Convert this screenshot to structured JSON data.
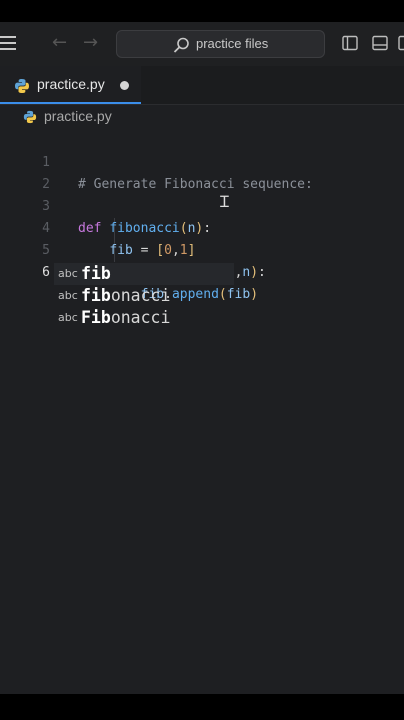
{
  "titlebar": {
    "menu_icon": "hamburger-menu-icon",
    "back_icon": "arrow-left-icon",
    "forward_icon": "arrow-right-icon",
    "search_icon": "search-icon",
    "search_label": "practice files",
    "layout_icons": [
      "toggle-sidebar-icon",
      "toggle-panel-icon"
    ]
  },
  "tab": {
    "label": "practice.py",
    "icon": "python-icon",
    "unsaved_indicator": "dot-icon"
  },
  "breadcrumb": {
    "label": "practice.py",
    "icon": "python-icon"
  },
  "editor": {
    "lines": [
      {
        "number": "1",
        "text": "# Generate Fibonacci sequence:"
      },
      {
        "number": "2",
        "text": ""
      },
      {
        "number": "3",
        "text": "def fibonacci(n):"
      },
      {
        "number": "4",
        "text": "    fib = [0,1]"
      },
      {
        "number": "5",
        "text": "    for i in range(2,n):"
      },
      {
        "number": "6",
        "text": "        fib.append(fib)"
      }
    ],
    "active_line": 6
  },
  "suggestions": [
    {
      "kind": "abc",
      "match": "fib",
      "rest": ""
    },
    {
      "kind": "abc",
      "match": "fib",
      "rest": "onacci"
    },
    {
      "kind": "abc",
      "match": "Fib",
      "rest": "onacci"
    }
  ],
  "colors": {
    "background": "#1e1f22",
    "keyword": "#c678dd",
    "function": "#61afef",
    "number": "#d19a66",
    "comment": "#8b9099",
    "accent": "#3b8eea"
  }
}
